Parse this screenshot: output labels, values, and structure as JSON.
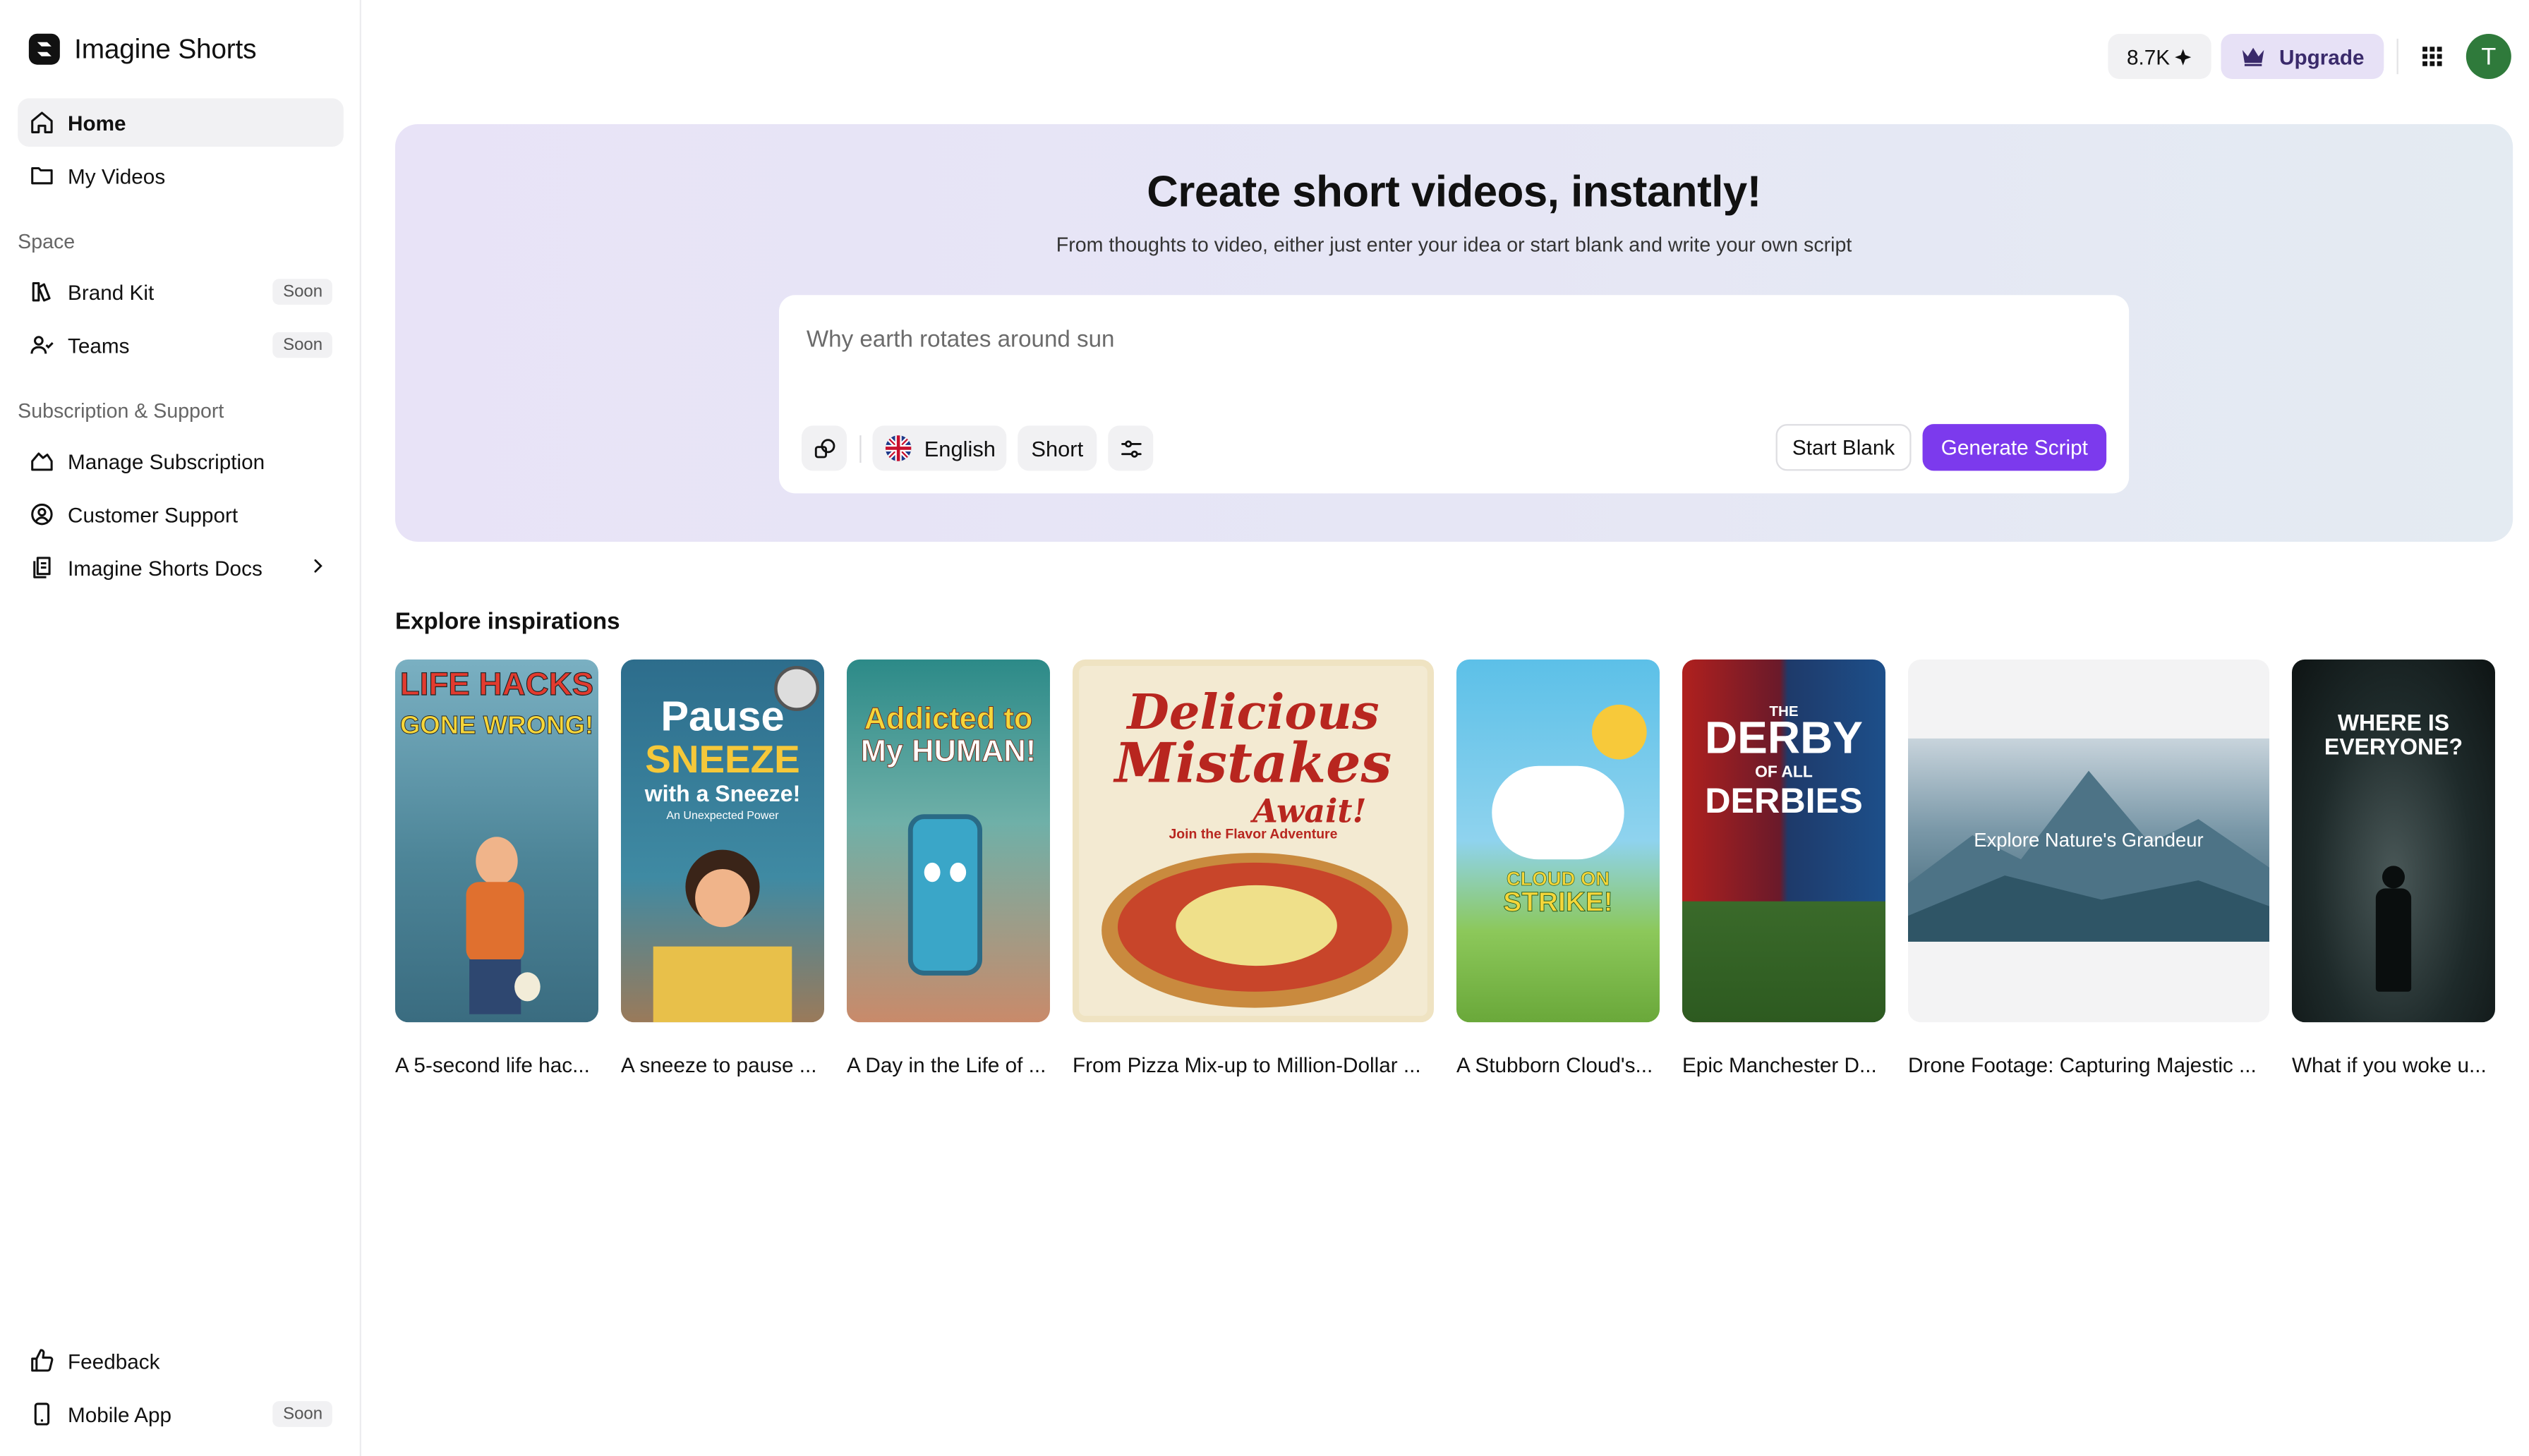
{
  "app": {
    "name": "Imagine Shorts"
  },
  "sidebar": {
    "nav": [
      {
        "label": "Home",
        "icon": "home-icon",
        "active": true
      },
      {
        "label": "My Videos",
        "icon": "folder-icon"
      }
    ],
    "space_label": "Space",
    "space_items": [
      {
        "label": "Brand Kit",
        "badge": "Soon",
        "icon": "brand-kit-icon"
      },
      {
        "label": "Teams",
        "badge": "Soon",
        "icon": "teams-icon"
      }
    ],
    "support_label": "Subscription & Support",
    "support_items": [
      {
        "label": "Manage Subscription",
        "icon": "subscription-icon"
      },
      {
        "label": "Customer Support",
        "icon": "support-icon"
      },
      {
        "label": "Imagine Shorts Docs",
        "icon": "docs-icon"
      }
    ],
    "bottom_items": [
      {
        "label": "Feedback",
        "icon": "thumbs-up-icon"
      },
      {
        "label": "Mobile App",
        "badge": "Soon",
        "icon": "phone-icon"
      }
    ]
  },
  "topbar": {
    "credits": "8.7K",
    "upgrade_label": "Upgrade",
    "avatar_initial": "T"
  },
  "hero": {
    "title": "Create short videos, instantly!",
    "subtitle": "From thoughts to video, either just enter your idea or start blank and write your own script",
    "input_placeholder": "Why earth rotates around sun",
    "language": "English",
    "length": "Short",
    "start_blank_label": "Start Blank",
    "generate_label": "Generate Script"
  },
  "explore": {
    "title": "Explore inspirations",
    "cards": [
      {
        "caption": "A 5-second life hac...",
        "art": [
          "LIFE HACKS",
          "GONE WRONG!"
        ]
      },
      {
        "caption": "A sneeze to pause ...",
        "art": [
          "Pause",
          "SNEEZE",
          "with a Sneeze!",
          "An Unexpected Power"
        ]
      },
      {
        "caption": "A Day in the Life of ...",
        "art": [
          "Addicted to",
          "My HUMAN!"
        ]
      },
      {
        "caption": "From Pizza Mix-up to Million-Dollar ...",
        "art": [
          "Delicious",
          "Mistakes",
          "Await!",
          "Join the Flavor Adventure"
        ]
      },
      {
        "caption": "A Stubborn Cloud's...",
        "art": [
          "CLOUD ON",
          "STRIKE!"
        ]
      },
      {
        "caption": "Epic Manchester D...",
        "art": [
          "THE",
          "DERBY",
          "OF ALL",
          "DERBIES"
        ]
      },
      {
        "caption": "Drone Footage: Capturing Majestic ...",
        "art": [
          "Explore Nature's Grandeur"
        ]
      },
      {
        "caption": "What if you woke u...",
        "art": [
          "WHERE IS",
          "EVERYONE?"
        ]
      }
    ]
  },
  "colors": {
    "accent": "#7c3aed",
    "upgrade_bg": "#e7e1f6",
    "avatar_bg": "#2f7a3b"
  }
}
